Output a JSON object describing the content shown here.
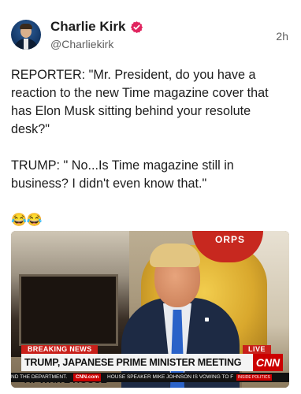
{
  "post": {
    "author_name": "Charlie Kirk",
    "handle": "@Charliekirk",
    "timestamp": "2h",
    "paragraphs": [
      "REPORTER: \"Mr. President, do you have a reaction to the new Time magazine cover that has Elon Musk sitting behind your resolute desk?\"",
      "TRUMP: \" No...Is Time magazine still in business? I didn't even know that.\""
    ],
    "emojis": "😂😂"
  },
  "media": {
    "breaking_label": "BREAKING NEWS",
    "live_label": "LIVE",
    "headline": "TRUMP, JAPANESE PRIME MINISTER MEETING AT WHITE HOUSE",
    "network_logo": "CNN",
    "ticker_left": "ND THE DEPARTMENT.",
    "ticker_cnn": "CNN.com",
    "ticker_right": "HOUSE SPEAKER MIKE JOHNSON IS VOWING TO F",
    "ticker_tag": "INSIDE POLITICS",
    "background_logo_text": "ORPS"
  },
  "icons": {
    "verified": "verified-badge-icon"
  },
  "colors": {
    "verified_badge": "#e0245e",
    "cnn_red": "#cc0000",
    "breaking_red": "#c9201a"
  }
}
